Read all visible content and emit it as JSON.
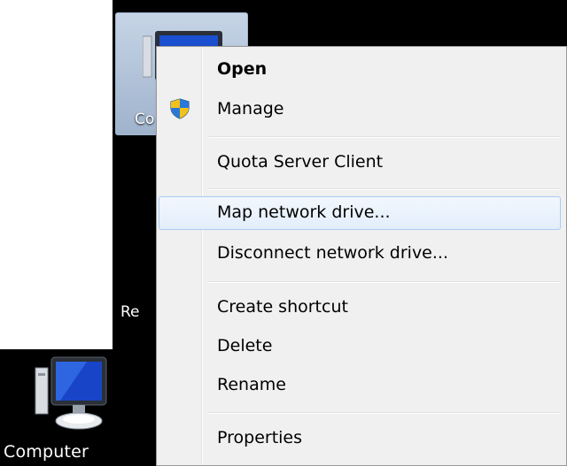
{
  "desktop": {
    "selected_icon_label": "Co",
    "second_icon_label": "Re",
    "bottom_icon_label": "Computer"
  },
  "context_menu": {
    "items": [
      {
        "label": "Open",
        "bold": true
      },
      {
        "label": "Manage",
        "icon": "uac-shield-icon"
      },
      {
        "label": "Quota Server Client"
      },
      {
        "label": "Map network drive...",
        "highlighted": true
      },
      {
        "label": "Disconnect network drive..."
      },
      {
        "label": "Create shortcut"
      },
      {
        "label": "Delete"
      },
      {
        "label": "Rename"
      },
      {
        "label": "Properties"
      }
    ]
  },
  "colors": {
    "menu_background": "#f0f0f0",
    "highlight_border": "#a8cbf1",
    "desktop_background": "#000000"
  }
}
